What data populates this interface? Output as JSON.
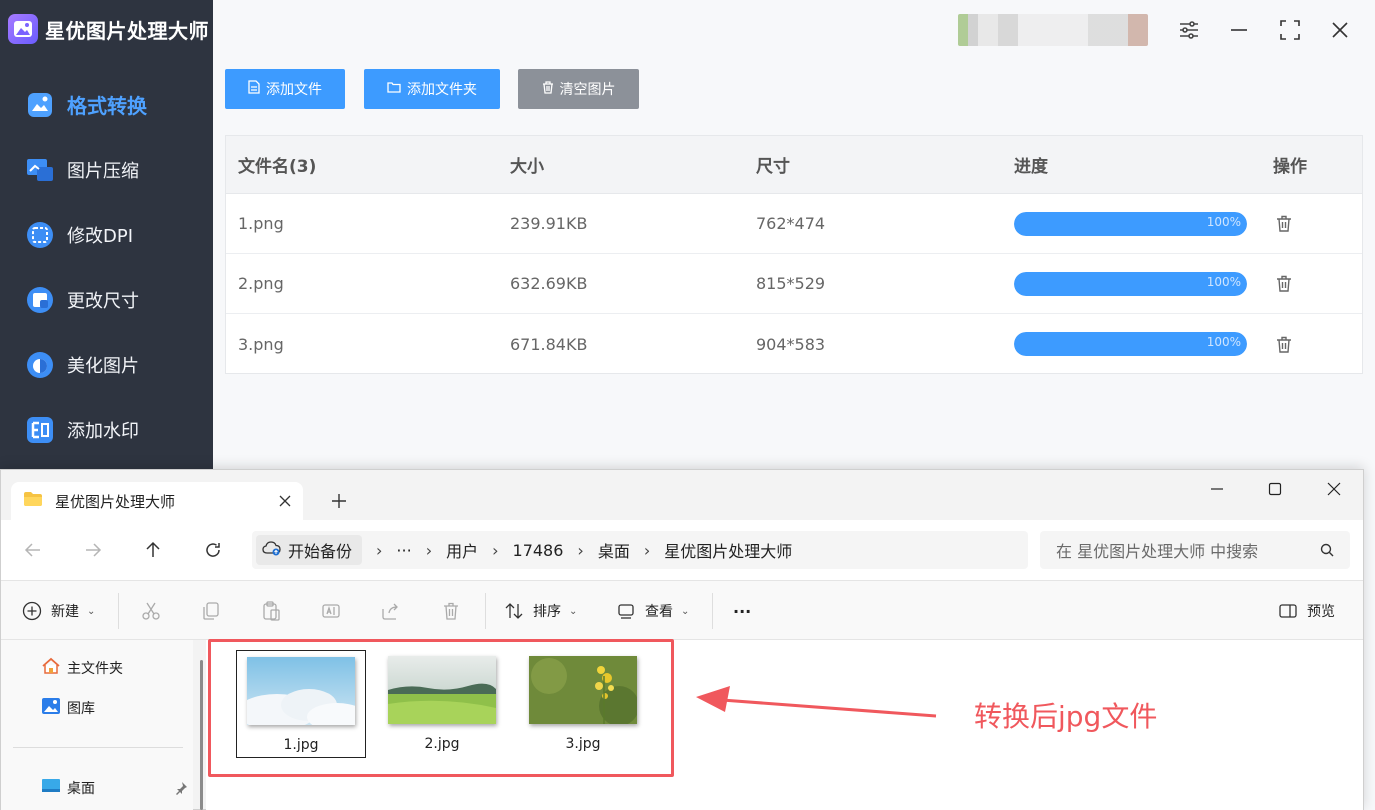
{
  "app": {
    "name": "星优图片处理大师",
    "nav": [
      {
        "label": "格式转换",
        "icon": "image-convert-icon",
        "active": true
      },
      {
        "label": "图片压缩",
        "icon": "image-compress-icon",
        "active": false
      },
      {
        "label": "修改DPI",
        "icon": "dpi-icon",
        "active": false
      },
      {
        "label": "更改尺寸",
        "icon": "resize-icon",
        "active": false
      },
      {
        "label": "美化图片",
        "icon": "beautify-icon",
        "active": false
      },
      {
        "label": "添加水印",
        "icon": "watermark-icon",
        "active": false
      }
    ],
    "toolbar": {
      "add_file": "添加文件",
      "add_folder": "添加文件夹",
      "clear": "清空图片"
    },
    "table": {
      "headers": {
        "name": "文件名(3)",
        "size": "大小",
        "dims": "尺寸",
        "progress": "进度",
        "action": "操作"
      },
      "rows": [
        {
          "name": "1.png",
          "size": "239.91KB",
          "dims": "762*474",
          "progress": 100,
          "progress_text": "100%"
        },
        {
          "name": "2.png",
          "size": "632.69KB",
          "dims": "815*529",
          "progress": 100,
          "progress_text": "100%"
        },
        {
          "name": "3.png",
          "size": "671.84KB",
          "dims": "904*583",
          "progress": 100,
          "progress_text": "100%"
        }
      ]
    },
    "colors": {
      "accent": "#3d9bff",
      "sidebar": "#2e3440",
      "annotation": "#f0585d"
    }
  },
  "explorer": {
    "tab_title": "星优图片处理大师",
    "breadcrumb": {
      "backup": "开始备份",
      "ellipsis": "···",
      "items": [
        "用户",
        "17486",
        "桌面",
        "星优图片处理大师"
      ]
    },
    "search": {
      "placeholder": "在 星优图片处理大师 中搜索"
    },
    "commands": {
      "new": "新建",
      "sort": "排序",
      "view": "查看",
      "more": "···",
      "preview": "预览"
    },
    "navpane": {
      "home": "主文件夹",
      "gallery": "图库",
      "desktop": "桌面"
    },
    "files": [
      {
        "name": "1.jpg",
        "selected": true
      },
      {
        "name": "2.jpg",
        "selected": false
      },
      {
        "name": "3.jpg",
        "selected": false
      }
    ]
  },
  "annotation": {
    "text": "转换后jpg文件"
  }
}
